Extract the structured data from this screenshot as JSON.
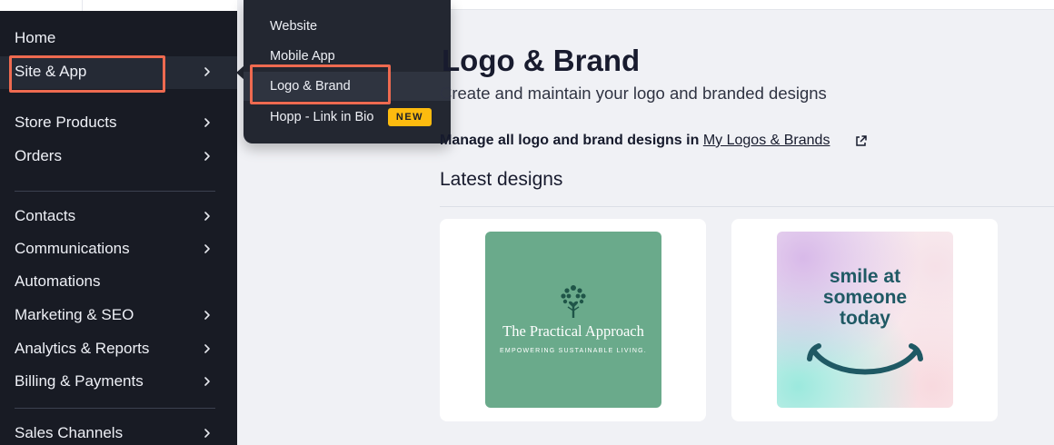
{
  "sidebar": {
    "items": [
      {
        "label": "Home",
        "has_chevron": false
      },
      {
        "label": "Site & App",
        "has_chevron": true,
        "active": true
      },
      {
        "label": "Store Products",
        "has_chevron": true
      },
      {
        "label": "Orders",
        "has_chevron": true
      },
      {
        "label": "Contacts",
        "has_chevron": true
      },
      {
        "label": "Communications",
        "has_chevron": true
      },
      {
        "label": "Automations",
        "has_chevron": false
      },
      {
        "label": "Marketing & SEO",
        "has_chevron": true
      },
      {
        "label": "Analytics & Reports",
        "has_chevron": true
      },
      {
        "label": "Billing & Payments",
        "has_chevron": true
      },
      {
        "label": "Sales Channels",
        "has_chevron": true
      }
    ]
  },
  "flyout": {
    "items": [
      {
        "label": "Website"
      },
      {
        "label": "Mobile App"
      },
      {
        "label": "Logo & Brand",
        "active": true
      },
      {
        "label": "Hopp - Link in Bio",
        "badge": "NEW"
      }
    ]
  },
  "main": {
    "title": "Logo & Brand",
    "subtitle": "Create and maintain your logo and branded designs",
    "manage_prefix": "Manage all logo and brand designs in",
    "manage_link": "My Logos & Brands",
    "manage_link_icon": "external-link-icon",
    "section_title": "Latest designs",
    "designs": [
      {
        "name": "The Practical Approach",
        "tagline": "EMPOWERING SUSTAINABLE LIVING.",
        "icon": "tree-icon"
      },
      {
        "lines": [
          "smile at",
          "someone",
          "today"
        ],
        "icon": "smile-icon"
      }
    ]
  },
  "colors": {
    "sidebar_bg": "#181b24",
    "flyout_bg": "#232731",
    "highlight": "#ee6a50",
    "badge_bg": "#fdbb0f",
    "page_bg": "#f0f1f5",
    "card_green": "#6aaa8b",
    "smile_teal": "#1f5964"
  }
}
